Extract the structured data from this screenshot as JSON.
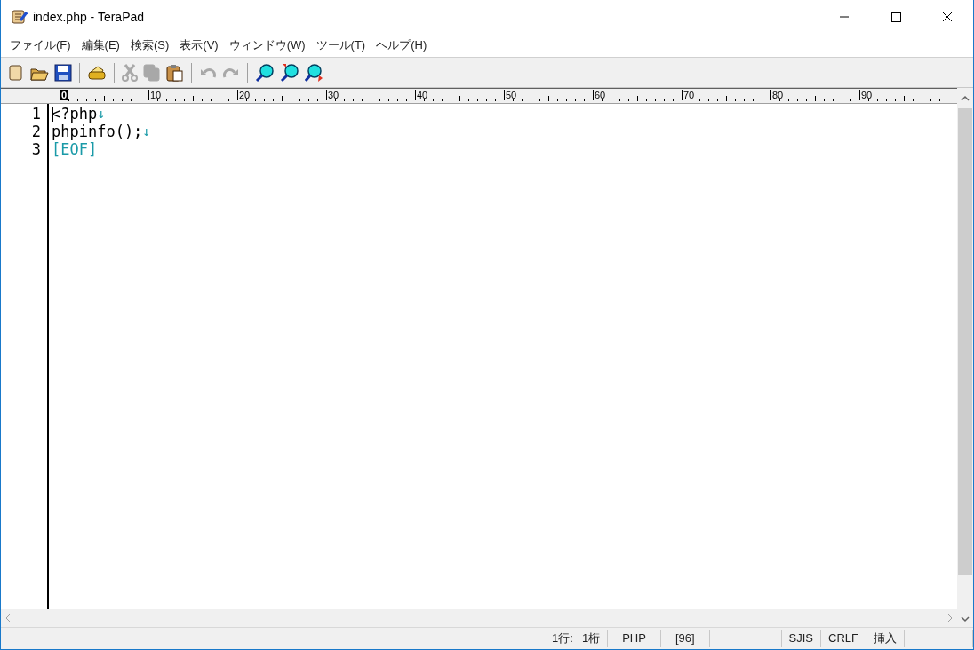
{
  "window": {
    "title": "index.php - TeraPad"
  },
  "menu": [
    {
      "label": "ファイル(F)"
    },
    {
      "label": "編集(E)"
    },
    {
      "label": "検索(S)"
    },
    {
      "label": "表示(V)"
    },
    {
      "label": "ウィンドウ(W)"
    },
    {
      "label": "ツール(T)"
    },
    {
      "label": "ヘルプ(H)"
    }
  ],
  "toolbar": [
    {
      "kind": "new",
      "disabled": false
    },
    {
      "kind": "open",
      "disabled": false
    },
    {
      "kind": "save",
      "disabled": false
    },
    {
      "kind": "separator"
    },
    {
      "kind": "print",
      "disabled": false
    },
    {
      "kind": "separator"
    },
    {
      "kind": "cut",
      "disabled": true
    },
    {
      "kind": "copy",
      "disabled": true
    },
    {
      "kind": "paste",
      "disabled": false
    },
    {
      "kind": "separator"
    },
    {
      "kind": "undo",
      "disabled": true
    },
    {
      "kind": "redo",
      "disabled": true
    },
    {
      "kind": "separator"
    },
    {
      "kind": "find",
      "disabled": false
    },
    {
      "kind": "find-prev",
      "disabled": false
    },
    {
      "kind": "find-next",
      "disabled": false
    }
  ],
  "ruler": {
    "labels": [
      {
        "text": "0",
        "current": true
      },
      {
        "text": "10",
        "current": false
      },
      {
        "text": "20",
        "current": false
      },
      {
        "text": "30",
        "current": false
      },
      {
        "text": "40",
        "current": false
      },
      {
        "text": "50",
        "current": false
      },
      {
        "text": "60",
        "current": false
      },
      {
        "text": "70",
        "current": false
      },
      {
        "text": "80",
        "current": false
      },
      {
        "text": "90",
        "current": false
      }
    ]
  },
  "editor": {
    "lines": [
      {
        "number": "1",
        "text": "<?php",
        "end_mark": "↓",
        "cursor": true
      },
      {
        "number": "2",
        "text": "phpinfo();",
        "end_mark": "↓",
        "cursor": false
      },
      {
        "number": "3",
        "text": "[EOF]",
        "kind": "eof",
        "cursor": false
      }
    ]
  },
  "status_bar": {
    "line": "1行:",
    "column": "1桁",
    "syntax": "PHP",
    "size": "[96]",
    "encoding": "SJIS",
    "line_ending": "CRLF",
    "mode": "挿入"
  }
}
